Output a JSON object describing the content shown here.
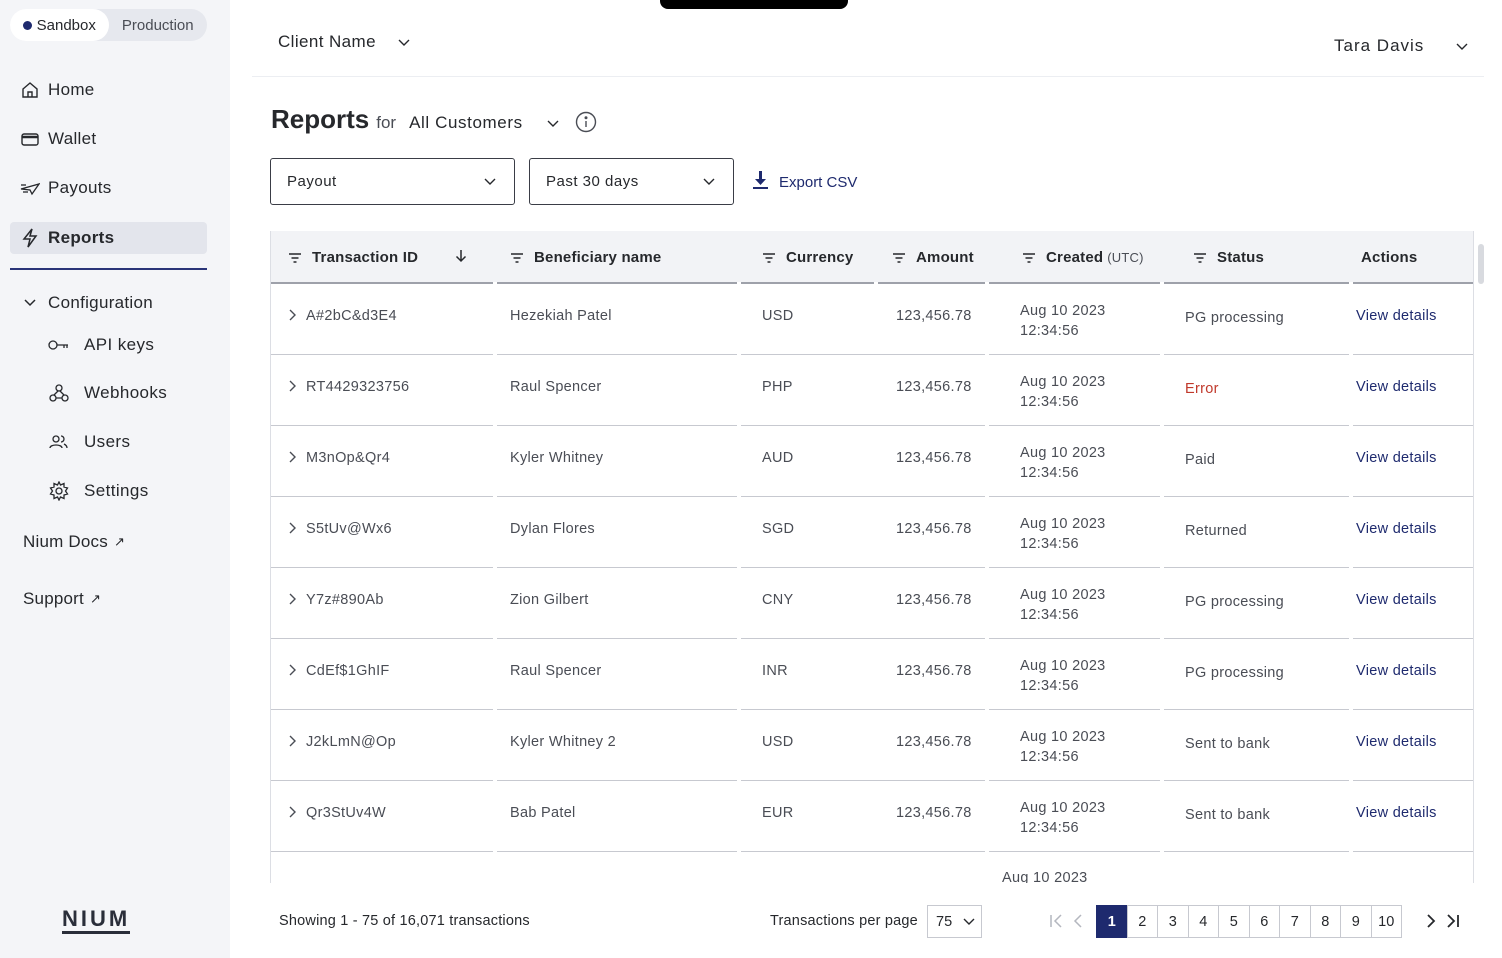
{
  "env_toggle": {
    "options": [
      "Sandbox",
      "Production"
    ],
    "active": "Sandbox"
  },
  "sidebar": {
    "items": [
      {
        "label": "Home",
        "icon": "home-icon"
      },
      {
        "label": "Wallet",
        "icon": "wallet-icon"
      },
      {
        "label": "Payouts",
        "icon": "payouts-icon"
      },
      {
        "label": "Reports",
        "icon": "bolt-icon",
        "active": true
      }
    ],
    "config": {
      "label": "Configuration",
      "items": [
        {
          "label": "API keys",
          "icon": "key-icon"
        },
        {
          "label": "Webhooks",
          "icon": "webhooks-icon"
        },
        {
          "label": "Users",
          "icon": "users-icon"
        },
        {
          "label": "Settings",
          "icon": "gear-icon"
        }
      ]
    },
    "links": [
      {
        "label": "Nium Docs",
        "icon": "external-link-icon"
      },
      {
        "label": "Support",
        "icon": "external-link-icon"
      }
    ],
    "logo": "NIUM"
  },
  "header": {
    "client": "Client Name",
    "user": "Tara Davis"
  },
  "page": {
    "title": "Reports",
    "for_label": "for",
    "customer": "All Customers"
  },
  "filters": {
    "type": "Payout",
    "period": "Past 30 days",
    "export_label": "Export CSV"
  },
  "table": {
    "columns": {
      "id": "Transaction ID",
      "name": "Beneficiary name",
      "currency": "Currency",
      "amount": "Amount",
      "created": "Created",
      "created_suffix": "(UTC)",
      "status": "Status",
      "actions": "Actions"
    },
    "action_label": "View details",
    "rows": [
      {
        "id": "A#2bC&d3E4",
        "name": "Hezekiah Patel",
        "currency": "USD",
        "amount": "123,456.78",
        "date": "Aug 10 2023",
        "time": "12:34:56",
        "status": "PG processing"
      },
      {
        "id": "RT4429323756",
        "name": "Raul Spencer",
        "currency": "PHP",
        "amount": "123,456.78",
        "date": "Aug 10 2023",
        "time": "12:34:56",
        "status": "Error"
      },
      {
        "id": "M3nOp&Qr4",
        "name": "Kyler Whitney",
        "currency": "AUD",
        "amount": "123,456.78",
        "date": "Aug 10 2023",
        "time": "12:34:56",
        "status": "Paid"
      },
      {
        "id": "S5tUv@Wx6",
        "name": "Dylan Flores",
        "currency": "SGD",
        "amount": "123,456.78",
        "date": "Aug 10 2023",
        "time": "12:34:56",
        "status": "Returned"
      },
      {
        "id": "Y7z#890Ab",
        "name": "Zion Gilbert",
        "currency": "CNY",
        "amount": "123,456.78",
        "date": "Aug 10 2023",
        "time": "12:34:56",
        "status": "PG processing"
      },
      {
        "id": "CdEf$1GhIF",
        "name": "Raul Spencer",
        "currency": "INR",
        "amount": "123,456.78",
        "date": "Aug 10 2023",
        "time": "12:34:56",
        "status": "PG processing"
      },
      {
        "id": "J2kLmN@Op",
        "name": "Kyler Whitney 2",
        "currency": "USD",
        "amount": "123,456.78",
        "date": "Aug 10 2023",
        "time": "12:34:56",
        "status": "Sent to bank"
      },
      {
        "id": "Qr3StUv4W",
        "name": "Bab Patel",
        "currency": "EUR",
        "amount": "123,456.78",
        "date": "Aug 10 2023",
        "time": "12:34:56",
        "status": "Sent to bank"
      }
    ],
    "partial_row": {
      "date": "Aug 10 2023"
    }
  },
  "footer": {
    "showing": "Showing 1 - 75 of 16,071 transactions",
    "per_page_label": "Transactions per page",
    "per_page": "75",
    "pages": [
      "1",
      "2",
      "3",
      "4",
      "5",
      "6",
      "7",
      "8",
      "9",
      "10"
    ],
    "current_page": "1"
  },
  "colors": {
    "accent": "#1e2a6e",
    "error": "#c0392b",
    "sidebar_bg": "#f4f5f8"
  }
}
